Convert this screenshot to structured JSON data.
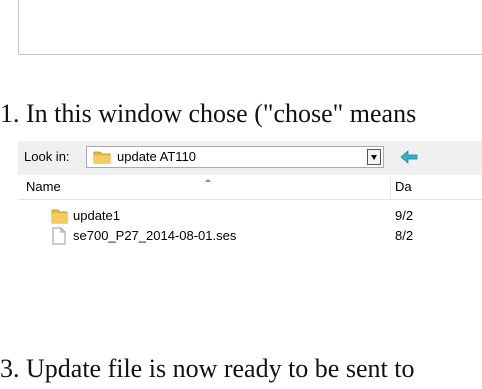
{
  "step2": {
    "text": "1. In this window chose (\"chose\" means"
  },
  "dialog": {
    "look_in_label": "Look in:",
    "current_folder": "update AT110",
    "columns": {
      "name": "Name",
      "date": "Da"
    },
    "files": [
      {
        "name": "update1",
        "date": "9/2",
        "icon": "folder-icon"
      },
      {
        "name": "se700_P27_2014-08-01.ses",
        "date": "8/2",
        "icon": "file-icon"
      }
    ]
  },
  "step3": {
    "text": "3. Update file is now ready to be sent to"
  },
  "colors": {
    "folder": "#e8b740",
    "back_arrow": "#2fb4c8"
  }
}
